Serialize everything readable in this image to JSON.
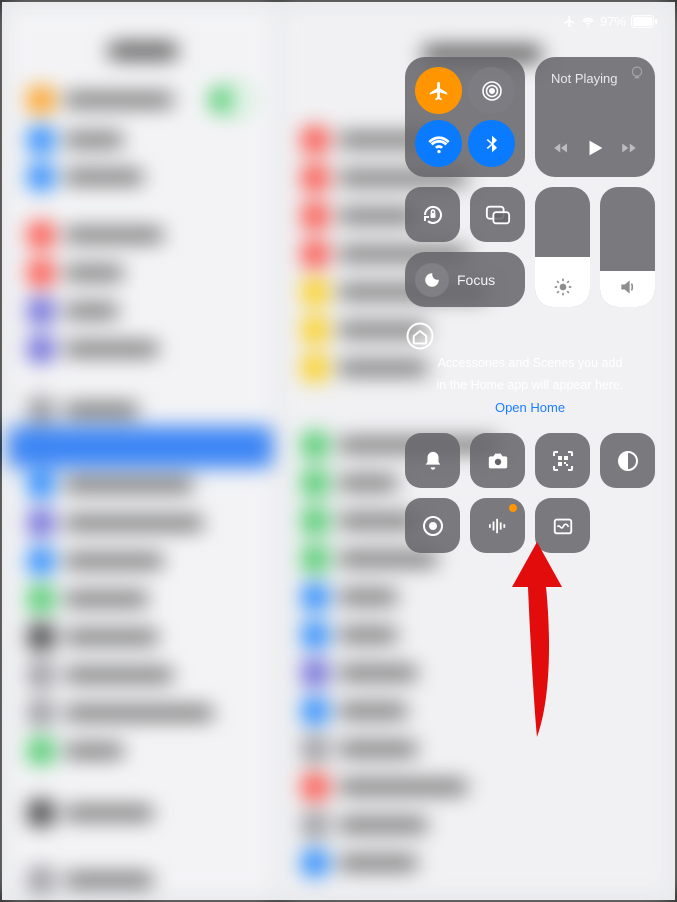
{
  "status": {
    "battery": "97%"
  },
  "connectivity": {
    "airplane": {
      "active": true
    },
    "airdrop": {
      "active": false
    },
    "wifi": {
      "active": true
    },
    "bluetooth": {
      "active": true
    }
  },
  "nowPlaying": {
    "title": "Not Playing"
  },
  "focus": {
    "label": "Focus"
  },
  "brightness": {
    "level_pct": 42
  },
  "volume": {
    "level_pct": 30
  },
  "home": {
    "text_line1": "Accessories and Scenes you add",
    "text_line2": "in the Home app will appear here.",
    "link": "Open Home"
  }
}
